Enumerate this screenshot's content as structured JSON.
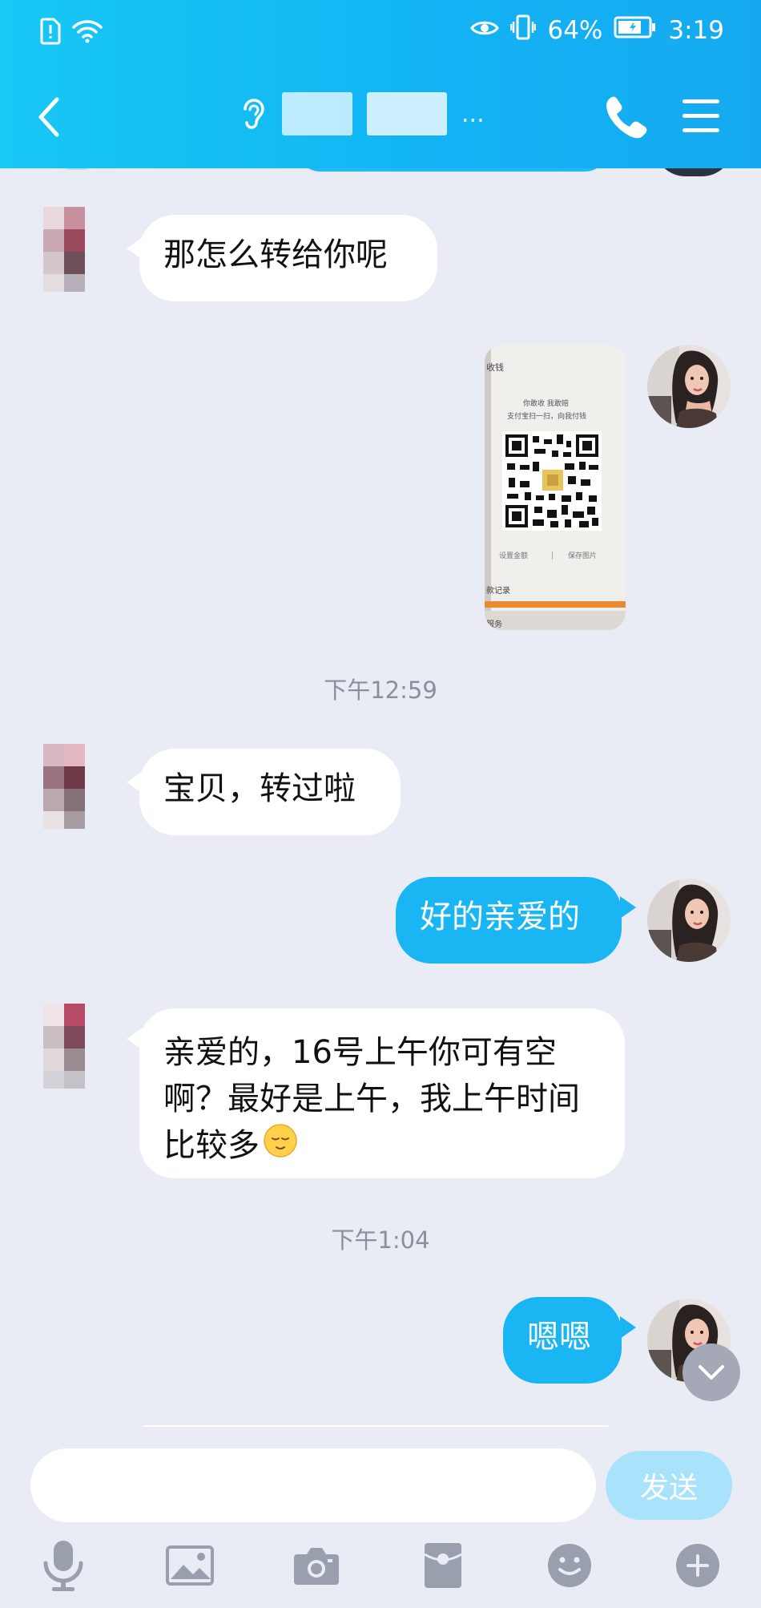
{
  "status_bar": {
    "battery_percent": "64%",
    "time": "3:19"
  },
  "nav": {
    "title_suffix": "..."
  },
  "messages": [
    {
      "text": "那怎么转给你呢"
    },
    {
      "text": "宝贝，转过啦"
    },
    {
      "text": "好的亲爱的"
    },
    {
      "text": "亲爱的，16号上午你可有空啊？最好是上午，我上午时间比较多"
    },
    {
      "text": "嗯嗯"
    }
  ],
  "timestamps": [
    "下午12:59",
    "下午1:04"
  ],
  "qr_image": {
    "header": "收钱",
    "line1": "你敢收 我敢赔",
    "line2": "支付宝扫一扫，向我付钱",
    "set_amount": "设置金额",
    "save_image": "保存图片",
    "records": "款记录",
    "service": "服务"
  },
  "input": {
    "placeholder": "",
    "send_label": "发送"
  },
  "icons": [
    "wifi-icon",
    "sim-alert-icon",
    "eye-icon",
    "vibrate-icon",
    "battery-icon",
    "back-icon",
    "ear-icon",
    "phone-icon",
    "menu-icon",
    "chevron-down-icon",
    "microphone-icon",
    "image-icon",
    "camera-icon",
    "red-packet-icon",
    "emoji-icon",
    "plus-icon"
  ],
  "colors": {
    "header_start": "#18c8f5",
    "header_end": "#16a9f0",
    "bubble_out": "#1ab6f3",
    "bubble_in": "#ffffff",
    "send_button": "#a8e3fb",
    "chat_bg": "#e9ecf5"
  }
}
